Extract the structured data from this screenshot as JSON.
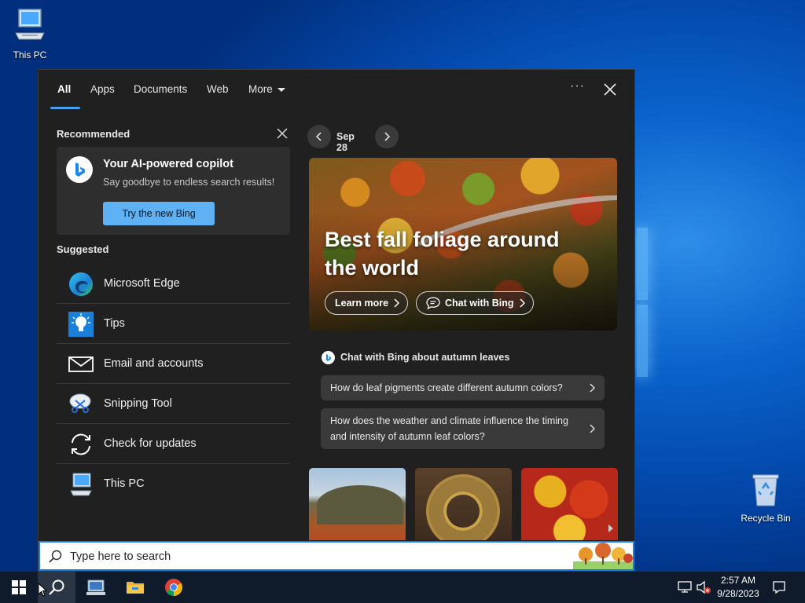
{
  "desktop": {
    "this_pc_label": "This PC",
    "recycle_bin_label": "Recycle Bin"
  },
  "search_panel": {
    "tabs": [
      "All",
      "Apps",
      "Documents",
      "Web",
      "More"
    ],
    "more_options_glyph": "···",
    "recommended": {
      "title": "Recommended",
      "card_title": "Your AI-powered copilot",
      "card_subtitle": "Say goodbye to endless search results!",
      "card_button": "Try the new Bing"
    },
    "suggested": {
      "title": "Suggested",
      "items": [
        {
          "label": "Microsoft Edge",
          "icon": "edge-icon"
        },
        {
          "label": "Tips",
          "icon": "tips-icon"
        },
        {
          "label": "Email and accounts",
          "icon": "mail-icon"
        },
        {
          "label": "Snipping Tool",
          "icon": "snipping-tool-icon"
        },
        {
          "label": "Check for updates",
          "icon": "update-icon"
        },
        {
          "label": "This PC",
          "icon": "computer-icon"
        }
      ]
    },
    "highlight": {
      "date": "Sep 28",
      "title": "Best fall foliage around the world",
      "learn_more": "Learn more",
      "chat_with_bing": "Chat with Bing"
    },
    "chat": {
      "heading": "Chat with Bing about autumn leaves",
      "questions": [
        "How do leaf pigments create different autumn colors?",
        "How does the weather and climate influence the timing and intensity of autumn leaf colors?"
      ]
    },
    "search_placeholder": "Type here to search"
  },
  "taskbar": {
    "time": "2:57 AM",
    "date": "9/28/2023"
  },
  "colors": {
    "accent": "#4aa0f0",
    "button": "#5eb1f2",
    "panel_bg": "#202020"
  }
}
